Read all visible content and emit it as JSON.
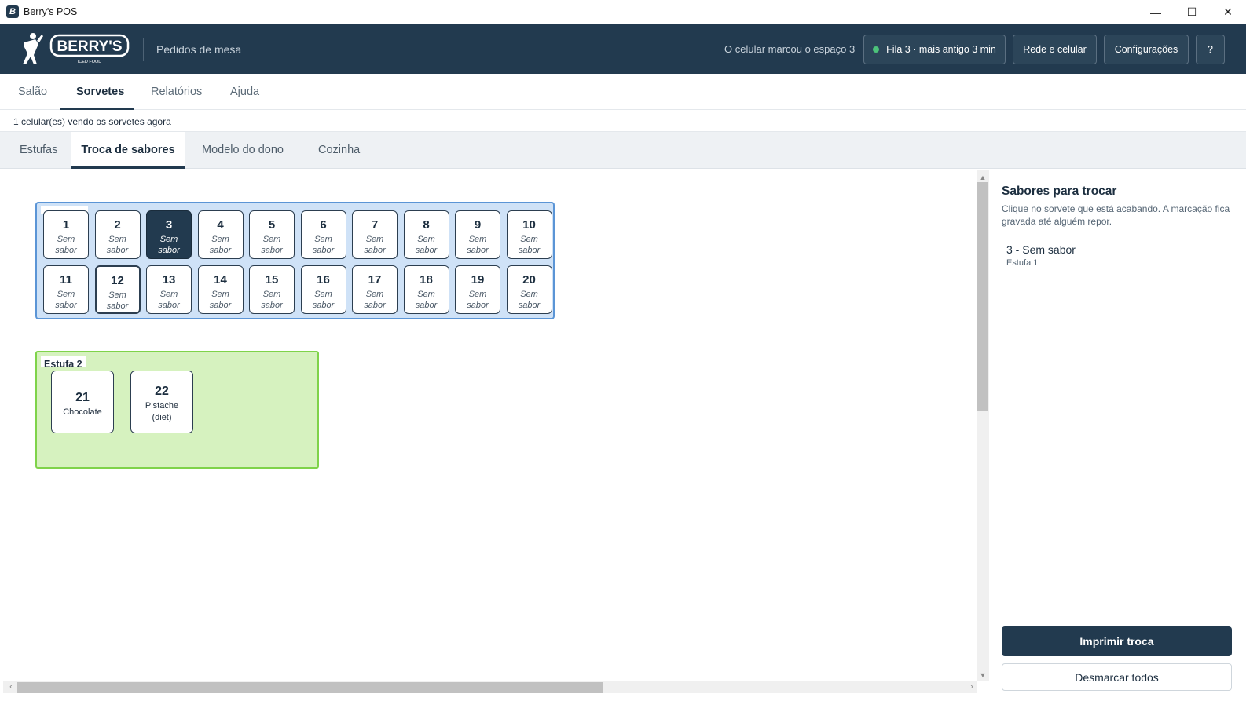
{
  "window": {
    "title": "Berry's POS",
    "icon": "app-icon"
  },
  "header": {
    "logo_text": "BERRY'S",
    "logo_sub": "ICED FOOD",
    "subtitle": "Pedidos de mesa",
    "status": "O celular marcou o espaço 3",
    "queue_label": "Fila 3 · mais antigo 3 min",
    "network_label": "Rede e celular",
    "config_label": "Configurações",
    "help_label": "?",
    "status_dot_color": "#4cc27a"
  },
  "main_tabs": [
    {
      "label": "Salão"
    },
    {
      "label": "Sorvetes",
      "active": true
    },
    {
      "label": "Relatórios"
    },
    {
      "label": "Ajuda"
    }
  ],
  "viewers_text": "1 celular(es) vendo os sorvetes agora",
  "sub_tabs": [
    {
      "label": "Estufas"
    },
    {
      "label": "Troca de sabores",
      "active": true
    },
    {
      "label": "Modelo do dono"
    },
    {
      "label": "Cozinha"
    }
  ],
  "estufa1": {
    "flavor_word_1": "Sem",
    "flavor_word_2": "sabor",
    "slots": [
      {
        "num": "1"
      },
      {
        "num": "2"
      },
      {
        "num": "3",
        "marked": true
      },
      {
        "num": "4"
      },
      {
        "num": "5"
      },
      {
        "num": "6"
      },
      {
        "num": "7"
      },
      {
        "num": "8"
      },
      {
        "num": "9"
      },
      {
        "num": "10"
      },
      {
        "num": "11"
      },
      {
        "num": "12"
      },
      {
        "num": "13"
      },
      {
        "num": "14"
      },
      {
        "num": "15"
      },
      {
        "num": "16"
      },
      {
        "num": "17"
      },
      {
        "num": "18"
      },
      {
        "num": "19"
      },
      {
        "num": "20"
      }
    ]
  },
  "estufa2": {
    "label": "Estufa 2",
    "slots": [
      {
        "num": "21",
        "flavor_line1": "Chocolate",
        "flavor_line2": ""
      },
      {
        "num": "22",
        "flavor_line1": "Pistache",
        "flavor_line2": "(diet)"
      }
    ]
  },
  "panel": {
    "title": "Sabores para trocar",
    "description": "Clique no sorvete que está acabando. A marcação fica gravada até alguém repor.",
    "item_title": "3 - Sem sabor",
    "item_sub": "Estufa 1",
    "print_label": "Imprimir troca",
    "clear_label": "Desmarcar todos"
  },
  "colors": {
    "header_bg": "#223a4f",
    "estufa1_bg": "#cfe2f7",
    "estufa1_border": "#5b95d6",
    "estufa2_bg": "#d6f2bf",
    "estufa2_border": "#7fd34a"
  }
}
